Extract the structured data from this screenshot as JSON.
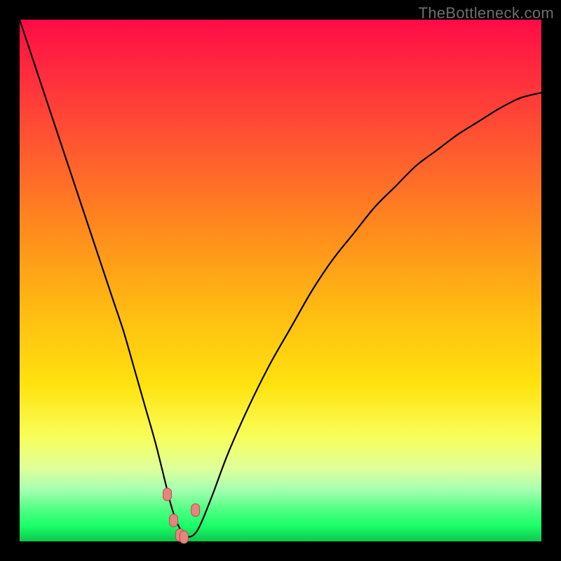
{
  "watermark": "TheBottleneck.com",
  "colors": {
    "curve": "#000000",
    "marker_fill": "#e6857f",
    "marker_stroke": "#b84b45"
  },
  "chart_data": {
    "type": "line",
    "title": "",
    "xlabel": "",
    "ylabel": "",
    "xlim": [
      0,
      100
    ],
    "ylim": [
      0,
      100
    ],
    "x": [
      0,
      2,
      4,
      6,
      8,
      10,
      12,
      14,
      16,
      18,
      20,
      22,
      24,
      26,
      28,
      29,
      30,
      31,
      32,
      33,
      34,
      35,
      37,
      40,
      44,
      48,
      52,
      56,
      60,
      64,
      68,
      72,
      76,
      80,
      84,
      88,
      92,
      96,
      100
    ],
    "values": [
      100,
      94,
      88,
      82,
      76,
      70,
      64,
      58,
      52,
      46,
      40,
      33,
      26,
      19,
      11,
      7,
      4,
      2,
      1,
      1,
      2,
      4,
      9,
      17,
      26,
      34,
      41,
      48,
      54,
      59,
      64,
      68,
      72,
      75,
      78,
      80.5,
      83,
      85,
      86
    ],
    "markers_x": [
      28.3,
      29.5,
      30.7,
      31.5,
      33.7
    ],
    "markers_y": [
      9,
      4,
      1.2,
      0.8,
      6
    ],
    "note": "values interpreted as percentage height from bottom of the gradient panel"
  }
}
